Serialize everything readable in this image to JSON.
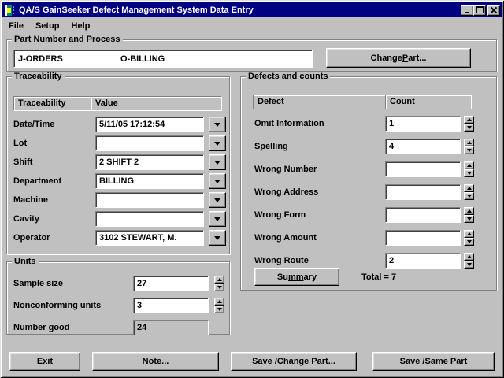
{
  "window": {
    "title": "QA/S GainSeeker Defect Management System Data Entry"
  },
  "colors": {
    "titlebar": "#000080",
    "face": "#c0c0c0",
    "field": "#ffffff"
  },
  "menu": {
    "items": [
      {
        "label": "File"
      },
      {
        "label": "Setup"
      },
      {
        "label": "Help"
      }
    ]
  },
  "part": {
    "label": "Part Number and Process",
    "part_number": "J-ORDERS",
    "process": "O-BILLING",
    "change_button": "Change Part..."
  },
  "traceability": {
    "label": "Traceability",
    "col1": "Traceability",
    "col2": "Value",
    "rows": [
      {
        "label": "Date/Time",
        "value": "5/11/05 17:12:54"
      },
      {
        "label": "Lot",
        "value": ""
      },
      {
        "label": "Shift",
        "value": "2 SHIFT 2"
      },
      {
        "label": "Department",
        "value": "BILLING"
      },
      {
        "label": "Machine",
        "value": ""
      },
      {
        "label": "Cavity",
        "value": ""
      },
      {
        "label": "Operator",
        "value": "3102 STEWART, M."
      }
    ]
  },
  "units": {
    "label": "Units",
    "rows": [
      {
        "label": "Sample size",
        "value": "27",
        "spinner": true,
        "readonly": false,
        "accel": "9"
      },
      {
        "label": "Nonconforming units",
        "value": "3",
        "spinner": true,
        "readonly": false
      },
      {
        "label": "Number good",
        "value": "24",
        "spinner": false,
        "readonly": true
      }
    ]
  },
  "defects": {
    "label": "Defects and counts",
    "col1": "Defect",
    "col2": "Count",
    "rows": [
      {
        "label": "Omit Information",
        "value": "1"
      },
      {
        "label": "Spelling",
        "value": "4"
      },
      {
        "label": "Wrong Number",
        "value": ""
      },
      {
        "label": "Wrong Address",
        "value": ""
      },
      {
        "label": "Wrong Form",
        "value": ""
      },
      {
        "label": "Wrong Amount",
        "value": ""
      },
      {
        "label": "Wrong Route",
        "value": "2"
      }
    ],
    "summary_button": "Summary",
    "total": "Total = 7"
  },
  "footer": {
    "exit": "Exit",
    "note": "Note...",
    "save_change": "Save / Change Part...",
    "save_same": "Save / Same Part"
  }
}
